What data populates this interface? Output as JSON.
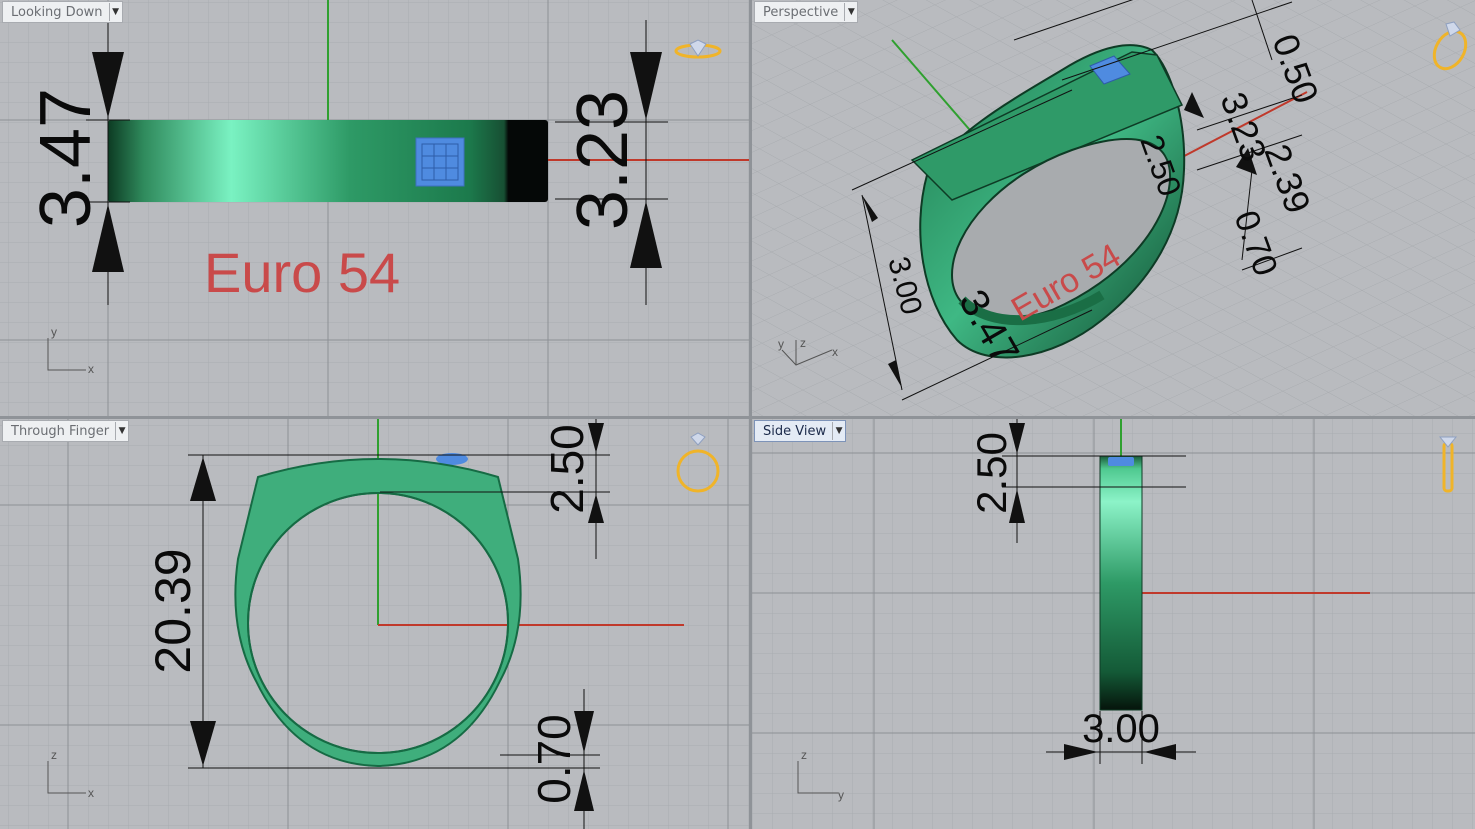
{
  "viewports": {
    "looking_down": {
      "label": "Looking Down",
      "dims": {
        "left": "3.47",
        "right": "3.23"
      },
      "engraving": "Euro 54",
      "axes": {
        "vertical": "y",
        "horizontal": "x"
      }
    },
    "perspective": {
      "label": "Perspective",
      "dims": {
        "top": "0.50",
        "upper": "3.23",
        "mid": "0.70",
        "inner": "2.50",
        "left": "3.47",
        "low": "3.00",
        "side": "2.39"
      },
      "engraving": "Euro 54",
      "axes": {
        "y": "y",
        "z": "z",
        "x": "x"
      }
    },
    "through_finger": {
      "label": "Through Finger",
      "dims": {
        "height": "20.39",
        "top": "2.50",
        "bottom": "0.70"
      },
      "axes": {
        "vertical": "z",
        "horizontal": "x"
      }
    },
    "side_view": {
      "label": "Side View",
      "dims": {
        "top": "2.50",
        "width": "3.00"
      },
      "axes": {
        "vertical": "z",
        "horizontal": "y"
      }
    }
  },
  "colors": {
    "viewport_bg": "#b9bbbf",
    "grid_minor": "#a9acb0",
    "grid_major": "#8d9095",
    "ring": "#3fae7c",
    "stone": "#4f8be0",
    "engraving": "#c94a4a",
    "axis_x": "#c0392b",
    "axis_y": "#2fa02f",
    "gizmo": "#f0b429"
  }
}
